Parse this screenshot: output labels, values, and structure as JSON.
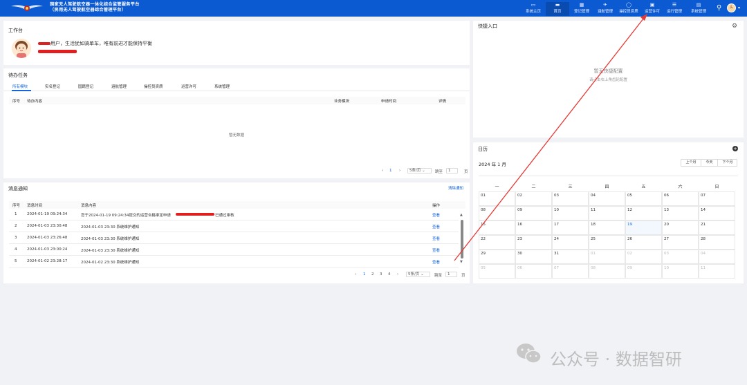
{
  "header": {
    "title_line1": "国家无人驾驶航空器一体化综合监管服务平台",
    "title_line2": "（民用无人驾驶航空器综合管理平台）",
    "nav": [
      {
        "icon": "desktop-icon",
        "glyph": "▭",
        "label": "系统主页"
      },
      {
        "icon": "monitor-icon",
        "glyph": "▬",
        "label": "首页"
      },
      {
        "icon": "register-icon",
        "glyph": "▦",
        "label": "登记管理"
      },
      {
        "icon": "drone-icon",
        "glyph": "✈",
        "label": "涵航管理"
      },
      {
        "icon": "shield-icon",
        "glyph": "◯",
        "label": "操控员资质"
      },
      {
        "icon": "card-icon",
        "glyph": "▣",
        "label": "运营许可"
      },
      {
        "icon": "ops-icon",
        "glyph": "☰",
        "label": "运行管理"
      },
      {
        "icon": "system-icon",
        "glyph": "▤",
        "label": "系统管理"
      }
    ],
    "active_nav": 1,
    "avatar_text": "头"
  },
  "workspace": {
    "title": "工作台",
    "greeting": "用户，生活犹如骑单车，唯有前进才能保持平衡"
  },
  "todo": {
    "title": "待办任务",
    "tabs": [
      "所有模块",
      "实名登记",
      "国籍登记",
      "涵航管理",
      "操控员资质",
      "运营许可",
      "系统管理"
    ],
    "active_tab": 0,
    "columns": [
      "序号",
      "待办内容",
      "业务模块",
      "申请时间",
      "详情"
    ],
    "empty_text": "暂无数据",
    "pager": {
      "prev": "‹",
      "page": "1",
      "next": "›",
      "page_size": "5条/页 ⌄",
      "goto_label": "跳至",
      "goto_value": "1",
      "page_unit": "页"
    }
  },
  "messages": {
    "title": "消息通知",
    "clear": "清除通知",
    "columns": [
      "序号",
      "消息时间",
      "消息内容",
      "操作"
    ],
    "rows": [
      {
        "no": "1",
        "time": "2024-01-19 09:24:34",
        "content": "您于2024-01-19 09:24:34提交的运营合格审定申请",
        "content_tail": "已通过审核",
        "action": "查看"
      },
      {
        "no": "2",
        "time": "2024-01-03 23:30:48",
        "content": "2024-01-03 23:30 系统维护通知",
        "content_tail": "",
        "action": "查看"
      },
      {
        "no": "3",
        "time": "2024-01-03 23:26:48",
        "content": "2024-01-03 23:30 系统维护通知",
        "content_tail": "",
        "action": "查看"
      },
      {
        "no": "4",
        "time": "2024-01-03 23:00:24",
        "content": "2024-01-03 23:30 系统维护通知",
        "content_tail": "",
        "action": "查看"
      },
      {
        "no": "5",
        "time": "2024-01-02 23:28:17",
        "content": "2024-01-02 23:30 系统维护通知",
        "content_tail": "",
        "action": "查看"
      }
    ],
    "pager": {
      "prev": "‹",
      "pages": [
        "1",
        "2",
        "3",
        "4"
      ],
      "next": "›",
      "page_size": "5条/页 ⌄",
      "goto_label": "跳至",
      "goto_value": "1",
      "page_unit": "页"
    }
  },
  "quick": {
    "title": "快捷入口",
    "empty_line1": "暂无快捷配置",
    "empty_line2": "请点击右上角齿轮配置"
  },
  "calendar": {
    "title": "日历",
    "month_label": "2024 年 1 月",
    "buttons": [
      "上个月",
      "今天",
      "下个月"
    ],
    "weekdays": [
      "一",
      "二",
      "三",
      "四",
      "五",
      "六",
      "日"
    ],
    "days": [
      "01",
      "02",
      "03",
      "04",
      "05",
      "06",
      "07",
      "08",
      "09",
      "10",
      "11",
      "12",
      "13",
      "14",
      "15",
      "16",
      "17",
      "18",
      "19",
      "20",
      "21",
      "22",
      "23",
      "24",
      "25",
      "26",
      "27",
      "28",
      "29",
      "30",
      "31",
      "01",
      "02",
      "03",
      "04",
      "05",
      "06",
      "07",
      "08",
      "09",
      "10",
      "11"
    ],
    "current_month_count": 31,
    "today_index": 18
  },
  "watermark": {
    "text": "公众号 · 数据智研"
  }
}
